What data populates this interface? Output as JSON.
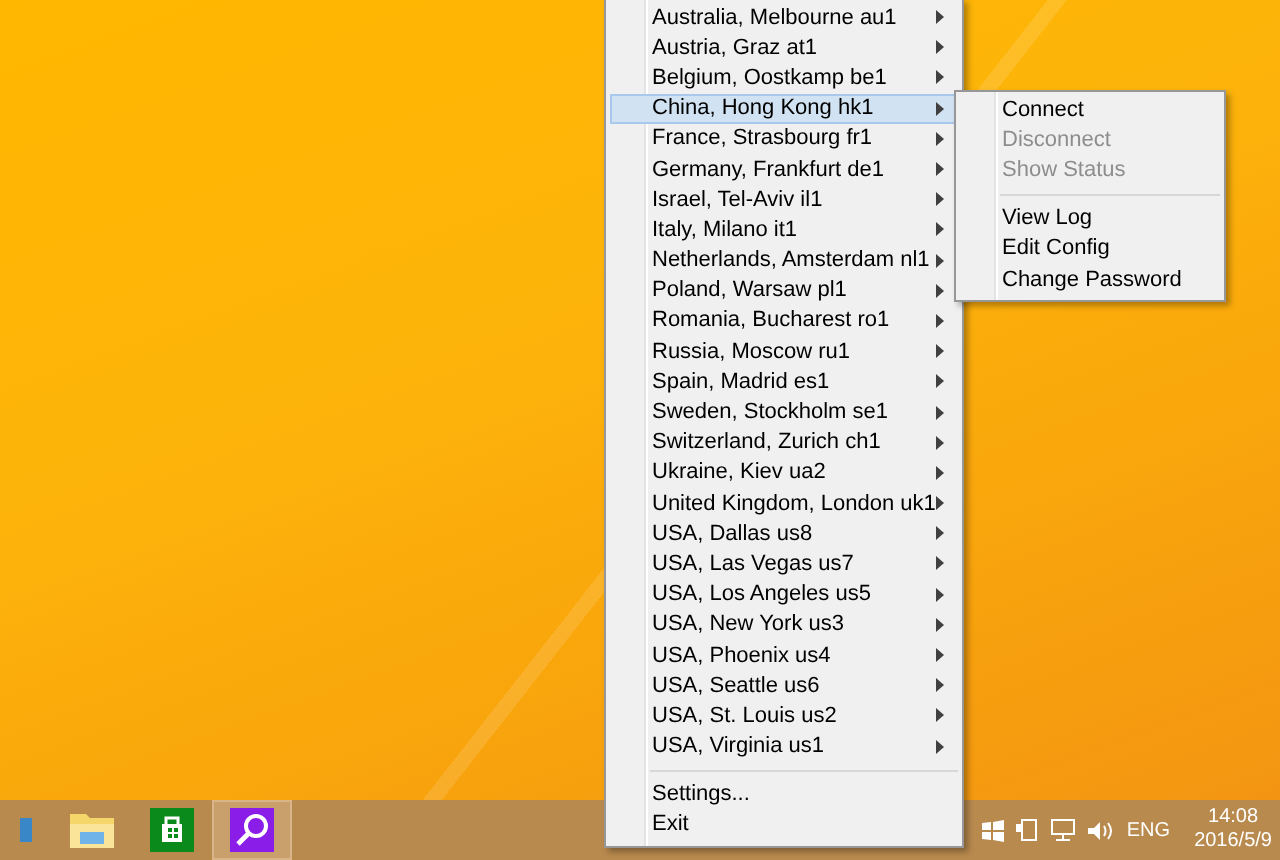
{
  "context_menu": {
    "items": [
      {
        "kind": "server",
        "label": "Australia, Melbourne au1",
        "selected": false
      },
      {
        "kind": "server",
        "label": "Austria, Graz at1",
        "selected": false
      },
      {
        "kind": "server",
        "label": "Belgium, Oostkamp be1",
        "selected": false
      },
      {
        "kind": "server",
        "label": "China, Hong Kong hk1",
        "selected": true
      },
      {
        "kind": "server",
        "label": "France, Strasbourg fr1",
        "selected": false
      },
      {
        "kind": "server",
        "label": "Germany, Frankfurt de1",
        "selected": false
      },
      {
        "kind": "server",
        "label": "Israel, Tel-Aviv il1",
        "selected": false
      },
      {
        "kind": "server",
        "label": "Italy, Milano it1",
        "selected": false
      },
      {
        "kind": "server",
        "label": "Netherlands, Amsterdam nl1",
        "selected": false
      },
      {
        "kind": "server",
        "label": "Poland, Warsaw pl1",
        "selected": false
      },
      {
        "kind": "server",
        "label": "Romania, Bucharest ro1",
        "selected": false
      },
      {
        "kind": "server",
        "label": "Russia, Moscow ru1",
        "selected": false
      },
      {
        "kind": "server",
        "label": "Spain, Madrid es1",
        "selected": false
      },
      {
        "kind": "server",
        "label": "Sweden, Stockholm se1",
        "selected": false
      },
      {
        "kind": "server",
        "label": "Switzerland, Zurich ch1",
        "selected": false
      },
      {
        "kind": "server",
        "label": "Ukraine, Kiev ua2",
        "selected": false
      },
      {
        "kind": "server",
        "label": "United Kingdom, London uk1",
        "selected": false
      },
      {
        "kind": "server",
        "label": "USA, Dallas us8",
        "selected": false
      },
      {
        "kind": "server",
        "label": "USA, Las Vegas us7",
        "selected": false
      },
      {
        "kind": "server",
        "label": "USA, Los Angeles us5",
        "selected": false
      },
      {
        "kind": "server",
        "label": "USA, New York us3",
        "selected": false
      },
      {
        "kind": "server",
        "label": "USA, Phoenix us4",
        "selected": false
      },
      {
        "kind": "server",
        "label": "USA, Seattle us6",
        "selected": false
      },
      {
        "kind": "server",
        "label": "USA, St. Louis us2",
        "selected": false
      },
      {
        "kind": "server",
        "label": "USA, Virginia us1",
        "selected": false
      },
      {
        "kind": "separator"
      },
      {
        "kind": "command",
        "label": "Settings..."
      },
      {
        "kind": "command",
        "label": "Exit"
      }
    ]
  },
  "submenu": {
    "items": [
      {
        "kind": "command",
        "label": "Connect",
        "disabled": false
      },
      {
        "kind": "command",
        "label": "Disconnect",
        "disabled": true
      },
      {
        "kind": "command",
        "label": "Show Status",
        "disabled": true
      },
      {
        "kind": "separator"
      },
      {
        "kind": "command",
        "label": "View Log",
        "disabled": false
      },
      {
        "kind": "command",
        "label": "Edit Config",
        "disabled": false
      },
      {
        "kind": "command",
        "label": "Change Password",
        "disabled": false
      }
    ]
  },
  "taskbar": {
    "apps": [
      {
        "kind": "partial",
        "selected": false
      },
      {
        "kind": "explorer",
        "selected": false
      },
      {
        "kind": "store",
        "selected": false
      },
      {
        "kind": "search",
        "selected": true
      }
    ],
    "tray": {
      "language": "ENG",
      "time": "14:08",
      "date": "2016/5/9"
    }
  }
}
